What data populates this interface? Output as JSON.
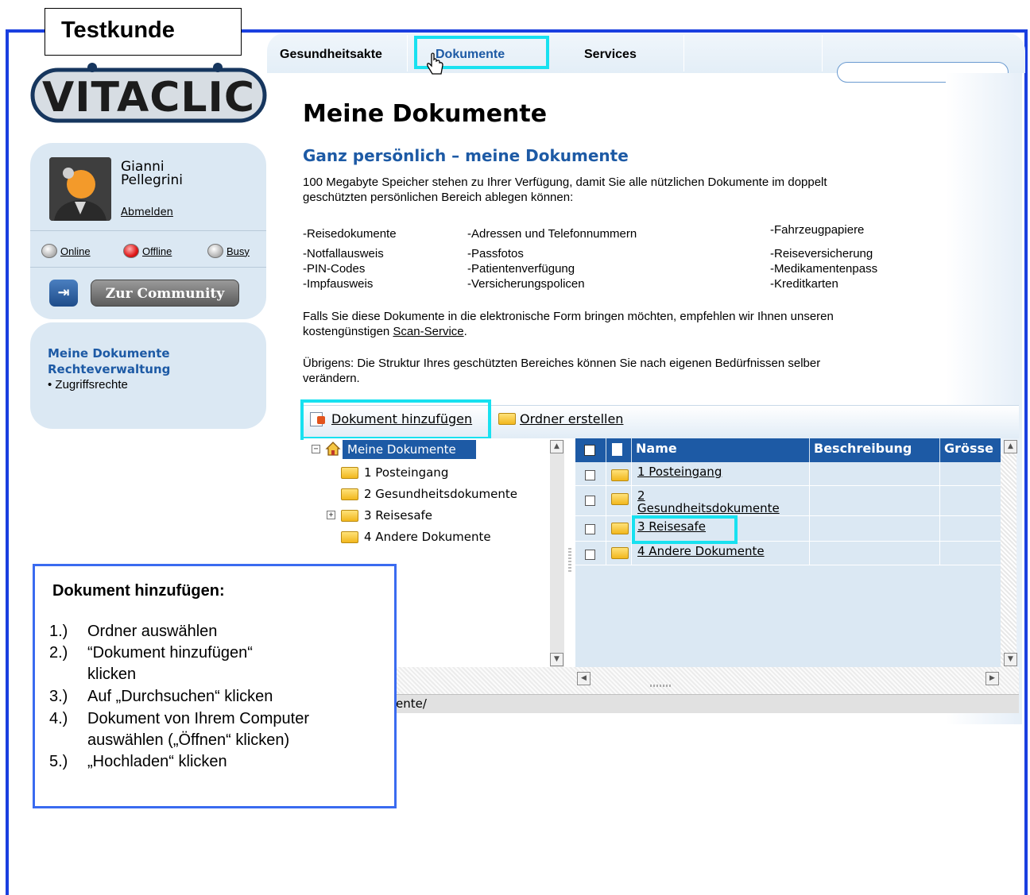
{
  "testkunde_label": "Testkunde",
  "logo_text": "VITACLIC",
  "user": {
    "first_name": "Gianni",
    "last_name": "Pellegrini",
    "logout": "Abmelden"
  },
  "status": {
    "online": "Online",
    "offline": "Offline",
    "busy": "Busy"
  },
  "community_button": "Zur Community",
  "sidebar": {
    "item1": "Meine Dokumente",
    "item2": "Rechteverwaltung",
    "sub1": "• Zugriffsrechte"
  },
  "tabs": {
    "health": "Gesundheitsakte",
    "docs": "Dokumente",
    "services": "Services"
  },
  "main": {
    "title": "Meine Dokumente",
    "subtitle": "Ganz persönlich – meine Dokumente",
    "intro_1": "100 Megabyte Speicher stehen zu Ihrer Verfügung, damit Sie alle nützlichen Dokumente im doppelt",
    "intro_2": "geschützten persönlichen Bereich ablegen können:",
    "list": {
      "c1": [
        "-Reisedokumente",
        "-Notfallausweis",
        "-PIN-Codes",
        "-Impfausweis"
      ],
      "c2": [
        "-Adressen und Telefonnummern",
        "-Passfotos",
        "-Patientenverfügung",
        "-Versicherungspolicen"
      ],
      "c3": [
        "-Fahrzeugpapiere",
        "-Reiseversicherung",
        "-Medikamentenpass",
        "-Kreditkarten"
      ]
    },
    "scan_1": "Falls Sie diese Dokumente in die elektronische Form bringen möchten, empfehlen wir Ihnen unseren",
    "scan_2a": "kostengünstigen ",
    "scan_link": "Scan-Service",
    "scan_2b": ".",
    "struct_1": "Übrigens: Die Struktur Ihres geschützten Bereiches können Sie nach eigenen Bedürfnissen selber",
    "struct_2": "verändern."
  },
  "toolbar": {
    "add_doc": "Dokument hinzufügen",
    "new_folder": "Ordner erstellen"
  },
  "tree": {
    "root": "Meine Dokumente",
    "items": [
      "1 Posteingang",
      "2 Gesundheitsdokumente",
      "3 Reisesafe",
      "4 Andere Dokumente"
    ]
  },
  "grid": {
    "headers": {
      "name": "Name",
      "desc": "Beschreibung",
      "size": "Grösse"
    },
    "rows": [
      "1 Posteingang",
      "2",
      "Gesundheitsdokumente",
      "3 Reisesafe",
      "4 Andere Dokumente"
    ]
  },
  "path_text": "ente/",
  "instructions": {
    "title": "Dokument hinzufügen:",
    "steps": [
      {
        "n": "1.)",
        "t": "Ordner auswählen"
      },
      {
        "n": "2.)",
        "t": "“Dokument hinzufügen“"
      },
      {
        "n": "",
        "t": "klicken"
      },
      {
        "n": "3.)",
        "t": "Auf „Durchsuchen“ klicken"
      },
      {
        "n": "4.)",
        "t": "Dokument von Ihrem Computer"
      },
      {
        "n": "",
        "t": "auswählen („Öffnen“ klicken)"
      },
      {
        "n": "5.)",
        "t": "„Hochladen“ klicken"
      }
    ]
  },
  "colors": {
    "frame": "#1a3fe0",
    "highlight": "#18e1f0",
    "accent_blue": "#1d5aa5",
    "panel": "#dbe8f3"
  }
}
